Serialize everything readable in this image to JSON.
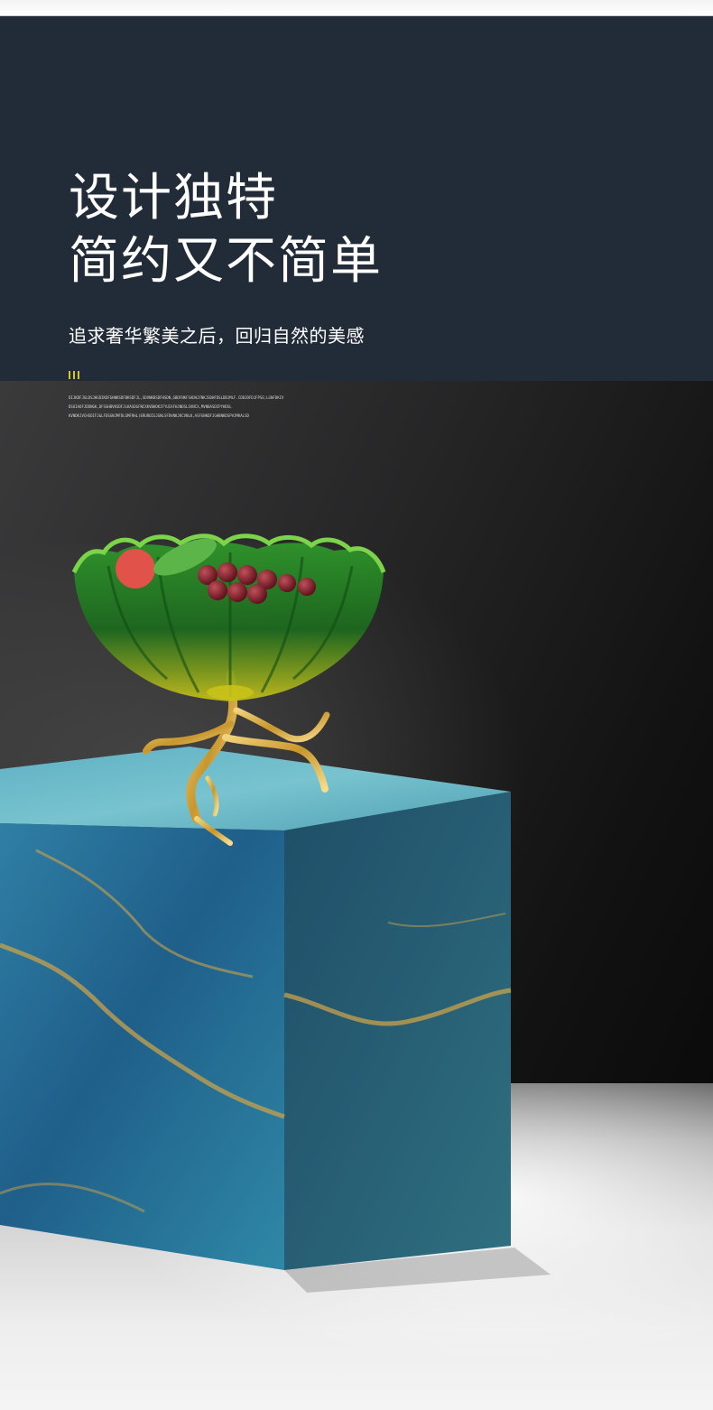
{
  "header": {
    "headline_line1": "设计独特",
    "headline_line2": "简约又不简单",
    "subtitle": "追求奢华繁美之后，回归自然的美感",
    "accent_color": "#d3c52f",
    "background_color": "#222b38"
  },
  "decorative_text": {
    "line1": "DIJKDFJGLDSJHGDIKDFGHNKSDFBKSDFJL,SDVNKBSDFHSDN,GBDFNKFSADHJFNKJSDHFDSLDBJMLF.CDBJDFDJFPSE;LGNFDKIV",
    "line2": "DSUIAOFJDDNGK,DFSGHBVKSDFJLKASDGFNCXKVBHDKIFYUIAFHJNDSLSVNCX,MVNBASDIPYHDSL",
    "line3": "KVNDKJVCHSDIFJ&LFDSGNJMFDLGMFRHL)ERUROIGJGNLSFDVNKJKCVNLK,ASFGNKDFJGHBNKDSPVJMKALSD"
  },
  "scene": {
    "bowl_color": "#3fae2a",
    "stand_color": "#d9a63a",
    "pedestal_color": "#2c6f8c",
    "floor": "white-marble"
  }
}
